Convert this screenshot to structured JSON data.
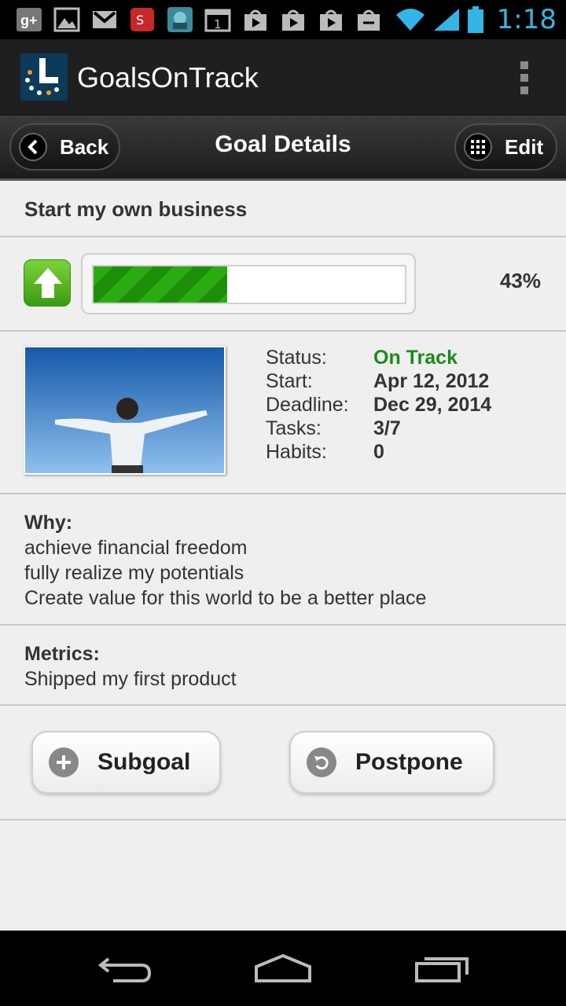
{
  "status_bar": {
    "time": "1:18",
    "notification_icons": [
      "google-plus-icon",
      "gallery-icon",
      "gmail-icon",
      "app-red-icon",
      "game-app-icon",
      "calendar-1-icon",
      "play-store-icon",
      "play-store-icon",
      "play-store-icon",
      "shopping-bag-icon"
    ]
  },
  "app_bar": {
    "title": "GoalsOnTrack"
  },
  "header": {
    "back_label": "Back",
    "title": "Goal Details",
    "edit_label": "Edit"
  },
  "goal": {
    "name": "Start my own business",
    "progress_percent": 43,
    "progress_label": "43%",
    "trend": "up"
  },
  "details": {
    "status_key": "Status:",
    "status_value": "On Track",
    "start_key": "Start:",
    "start_value": "Apr 12, 2012",
    "deadline_key": "Deadline:",
    "deadline_value": "Dec 29, 2014",
    "tasks_key": "Tasks:",
    "tasks_value": "3/7",
    "habits_key": "Habits:",
    "habits_value": "0"
  },
  "why": {
    "label": "Why:",
    "lines": [
      "achieve financial freedom",
      "fully realize my potentials",
      "Create value for this world to be a better place"
    ]
  },
  "metrics": {
    "label": "Metrics:",
    "text": "Shipped my first product"
  },
  "actions": {
    "subgoal_label": "Subgoal",
    "postpone_label": "Postpone"
  },
  "colors": {
    "accent_blue": "#33b5e5",
    "status_green": "#1a8a1a",
    "progress_green": "#2bab12"
  }
}
